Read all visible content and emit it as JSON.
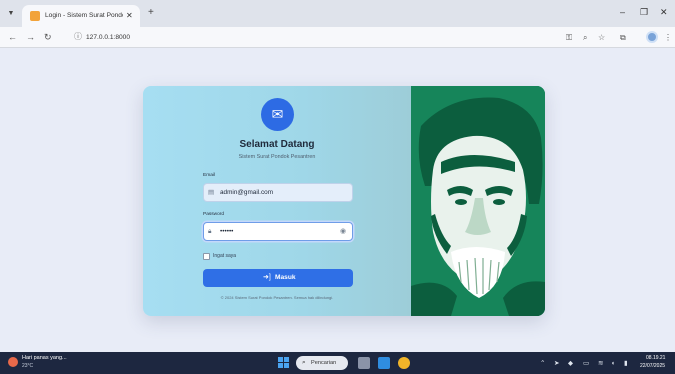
{
  "browser": {
    "tab_title": "Login - Sistem Surat Pondok Pe",
    "tab_close": "✕",
    "new_tab": "+",
    "url": "127.0.0.1:8000"
  },
  "login": {
    "title": "Selamat Datang",
    "subtitle": "Sistem Surat Pondok Pesantren",
    "email_label": "Email",
    "email_value": "admin@gmail.com",
    "password_label": "Password",
    "password_value": "••••••",
    "remember_label": "Ingat saya",
    "submit_label": "Masuk",
    "footer": "© 2024 Sistem Surat Pondok Pesantren. Semua hak dilindungi."
  },
  "taskbar": {
    "weather_title": "Hari panas yang...",
    "weather_temp": "23°C",
    "search_label": "Pencarian",
    "time": "08.19.21",
    "date": "22/07/2025"
  },
  "colors": {
    "primary_button": "#2f6fe6",
    "portrait_bg": "#16855a",
    "card_left_bg": "#a6def2"
  }
}
